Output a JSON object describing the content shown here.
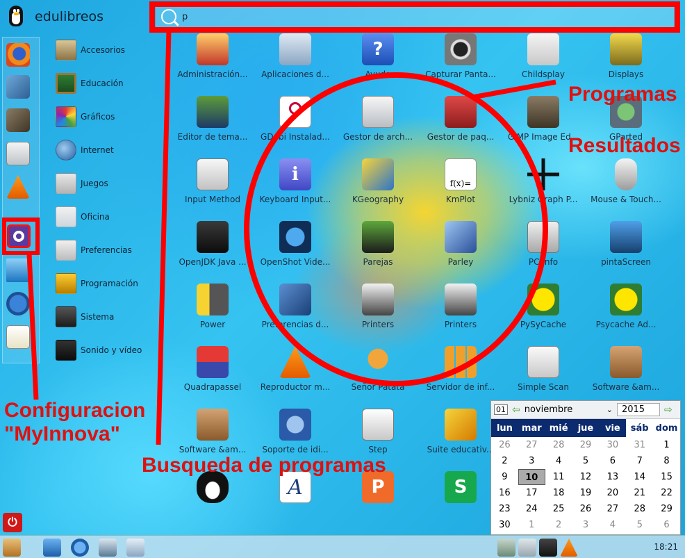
{
  "header": {
    "brand": "edulibreos",
    "search_value": "p"
  },
  "favorites": [
    {
      "icon": "firefox-icon"
    },
    {
      "icon": "bird-icon"
    },
    {
      "icon": "gimp-icon"
    },
    {
      "icon": "file-cabinet-icon"
    },
    {
      "icon": "vlc-icon"
    },
    {
      "icon": "gear-icon"
    },
    {
      "icon": "monitor-icon"
    },
    {
      "icon": "play-icon"
    },
    {
      "icon": "notepad-icon"
    }
  ],
  "categories": [
    {
      "label": "Accesorios"
    },
    {
      "label": "Educación"
    },
    {
      "label": "Gráficos"
    },
    {
      "label": "Internet"
    },
    {
      "label": "Juegos"
    },
    {
      "label": "Oficina"
    },
    {
      "label": "Preferencias"
    },
    {
      "label": "Programación"
    },
    {
      "label": "Sistema"
    },
    {
      "label": "Sonido y vídeo"
    }
  ],
  "apps": [
    {
      "label": "Administración..."
    },
    {
      "label": "Aplicaciones d..."
    },
    {
      "label": "Ayuda"
    },
    {
      "label": "Capturar Panta..."
    },
    {
      "label": "Childsplay"
    },
    {
      "label": "Displays"
    },
    {
      "label": "Editor de tema..."
    },
    {
      "label": "GDebi Instalad..."
    },
    {
      "label": "Gestor de arch..."
    },
    {
      "label": "Gestor de paq..."
    },
    {
      "label": "GIMP Image Ed..."
    },
    {
      "label": "GParted"
    },
    {
      "label": "Input Method"
    },
    {
      "label": "Keyboard Input..."
    },
    {
      "label": "KGeography"
    },
    {
      "label": "KmPlot"
    },
    {
      "label": "Lybniz Graph P..."
    },
    {
      "label": "Mouse & Touch..."
    },
    {
      "label": "OpenJDK Java ..."
    },
    {
      "label": "OpenShot Vide..."
    },
    {
      "label": "Parejas"
    },
    {
      "label": "Parley"
    },
    {
      "label": "PC Info"
    },
    {
      "label": "pintaScreen"
    },
    {
      "label": "Power"
    },
    {
      "label": "Preferencias d..."
    },
    {
      "label": "Printers"
    },
    {
      "label": "Printers"
    },
    {
      "label": "PySyCache"
    },
    {
      "label": "Psycache Ad..."
    },
    {
      "label": "Quadrapassel"
    },
    {
      "label": "Reproductor m..."
    },
    {
      "label": "Señor Patata"
    },
    {
      "label": "Servidor de inf..."
    },
    {
      "label": "Simple Scan"
    },
    {
      "label": "Software &am..."
    },
    {
      "label": "Software &am..."
    },
    {
      "label": "Soporte de idi..."
    },
    {
      "label": "Step"
    },
    {
      "label": "Suite educativ..."
    },
    {
      "label": ""
    },
    {
      "label": ""
    },
    {
      "label": ""
    },
    {
      "label": ""
    },
    {
      "label": ""
    },
    {
      "label": ""
    }
  ],
  "calendar": {
    "month": "noviembre",
    "year": "2015",
    "weekdays": [
      "lun",
      "mar",
      "mié",
      "jue",
      "vie",
      "sáb",
      "dom"
    ],
    "cells": [
      "26",
      "27",
      "28",
      "29",
      "30",
      "31",
      "1",
      "2",
      "3",
      "4",
      "5",
      "6",
      "7",
      "8",
      "9",
      "10",
      "11",
      "12",
      "13",
      "14",
      "15",
      "16",
      "17",
      "18",
      "19",
      "20",
      "21",
      "22",
      "23",
      "24",
      "25",
      "26",
      "27",
      "28",
      "29",
      "30",
      "1",
      "2",
      "3",
      "4",
      "5",
      "6"
    ]
  },
  "taskbar": {
    "clock": "18:21"
  },
  "annotations": {
    "programas": "Programas",
    "resultados": "Resultados",
    "configuracion_line1": "Configuracion",
    "configuracion_line2": "\"MyInnova\"",
    "busqueda": "Busqueda de programas"
  },
  "colors": {
    "annotation": "#e01010",
    "calendar_header": "#0c2a6e",
    "power": "#d01818"
  }
}
